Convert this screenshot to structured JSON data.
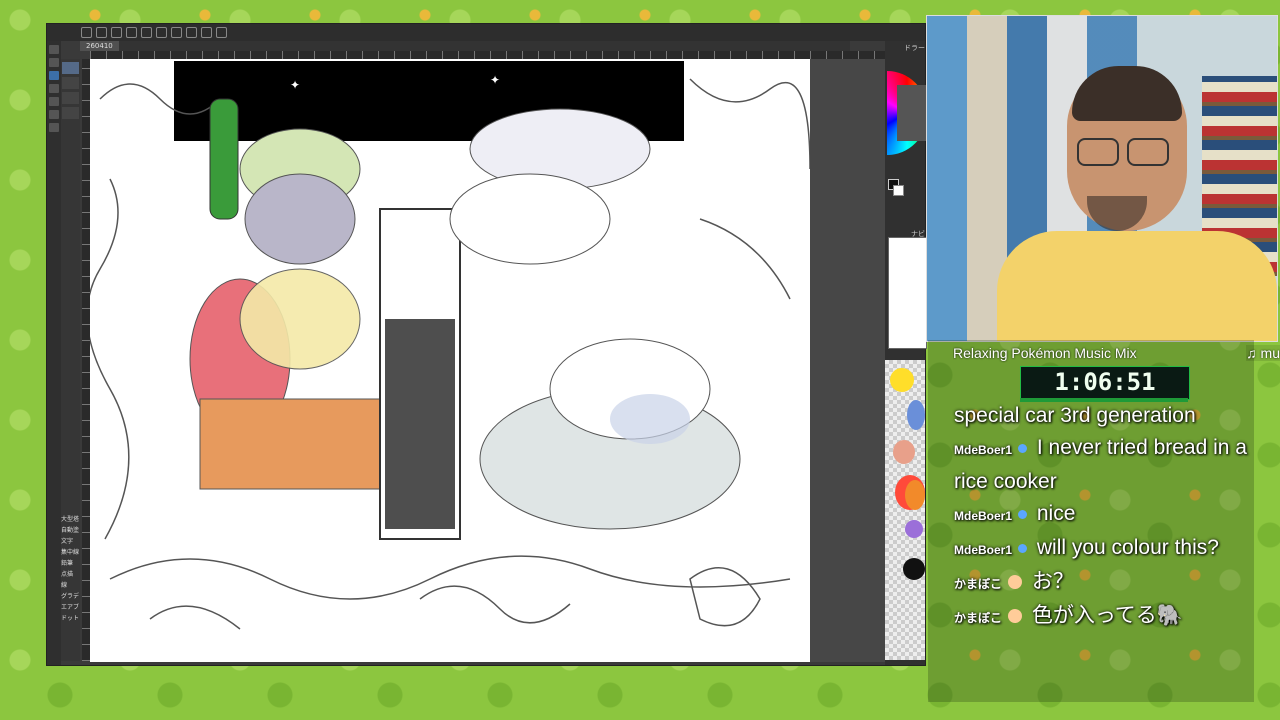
{
  "app": {
    "tab_label": "260410",
    "panel_label_top": "ドラー",
    "panel_label_mid": "ナビ",
    "sub_tool_labels": [
      "大型塔",
      "自動塗",
      "文字",
      "集中線",
      "鉛筆",
      "点描",
      "線",
      "グラデ",
      "エアブ",
      "ドット"
    ]
  },
  "overlay": {
    "ticker_text": "Relaxing Pokémon Music Mix",
    "ticker_note": "♫ mu",
    "timer": "1:06:51"
  },
  "chat": {
    "messages": [
      {
        "user": "",
        "text": "special car 3rd generation"
      },
      {
        "user": "MdeBoer1",
        "text": "I never tried bread in a rice cooker"
      },
      {
        "user": "MdeBoer1",
        "text": "nice"
      },
      {
        "user": "MdeBoer1",
        "text": "will you colour this?"
      },
      {
        "user": "かまぼこ",
        "text": "お？"
      },
      {
        "user": "かまぼこ",
        "text": "色が入ってる🐘"
      }
    ]
  },
  "colors": {
    "accent": "#3c6fa8",
    "timer_green": "#1e9a38",
    "palette": [
      "#ffde2a",
      "#6a8fd9",
      "#e8a08a",
      "#ff4a3a",
      "#f28a2a",
      "#9b6fd9",
      "#111111"
    ]
  },
  "icons": [
    "pen-icon",
    "undo-icon",
    "redo-icon",
    "brush-icon",
    "eraser-icon",
    "fill-icon",
    "text-icon",
    "select-icon"
  ]
}
